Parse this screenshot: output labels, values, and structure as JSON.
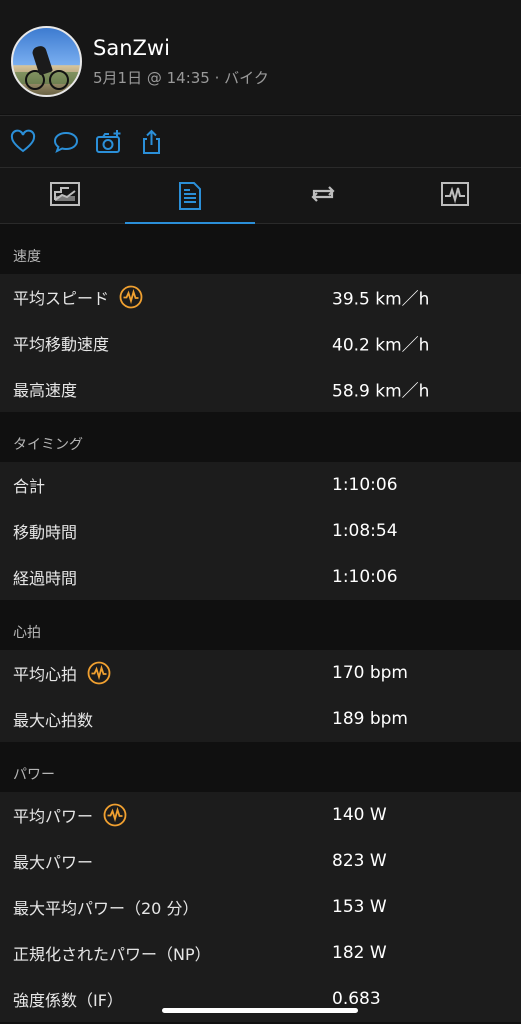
{
  "header": {
    "username": "SanZwi",
    "subline": "5月1日 @ 14:35 · バイク"
  },
  "actions": [
    "heart-icon",
    "comment-icon",
    "camera-add-icon",
    "share-icon"
  ],
  "colors": {
    "accent": "#2b8fd8",
    "icon_orange": "#f0a030",
    "row_bg": "#1c1c1c",
    "page_bg": "#101010"
  },
  "tabs": [
    "chart-tab-icon",
    "details-tab-icon",
    "laps-tab-icon",
    "graph-tab-icon"
  ],
  "sections": [
    {
      "title": "速度",
      "rows": [
        {
          "label": "平均スピード",
          "value": "39.5 km／h",
          "icon": true
        },
        {
          "label": "平均移動速度",
          "value": "40.2 km／h",
          "icon": false
        },
        {
          "label": "最高速度",
          "value": "58.9 km／h",
          "icon": false
        }
      ]
    },
    {
      "title": "タイミング",
      "rows": [
        {
          "label": "合計",
          "value": "1:10:06",
          "icon": false
        },
        {
          "label": "移動時間",
          "value": "1:08:54",
          "icon": false
        },
        {
          "label": "経過時間",
          "value": "1:10:06",
          "icon": false
        }
      ]
    },
    {
      "title": "心拍",
      "rows": [
        {
          "label": "平均心拍",
          "value": "170 bpm",
          "icon": true
        },
        {
          "label": "最大心拍数",
          "value": "189 bpm",
          "icon": false
        }
      ]
    },
    {
      "title": "パワー",
      "rows": [
        {
          "label": "平均パワー",
          "value": "140 W",
          "icon": true
        },
        {
          "label": "最大パワー",
          "value": "823 W",
          "icon": false
        },
        {
          "label": "最大平均パワー（20 分）",
          "value": "153 W",
          "icon": false
        },
        {
          "label": "正規化されたパワー（NP）",
          "value": "182 W",
          "icon": false
        },
        {
          "label": "強度係数（IF）",
          "value": "0.683",
          "icon": false
        }
      ]
    }
  ]
}
